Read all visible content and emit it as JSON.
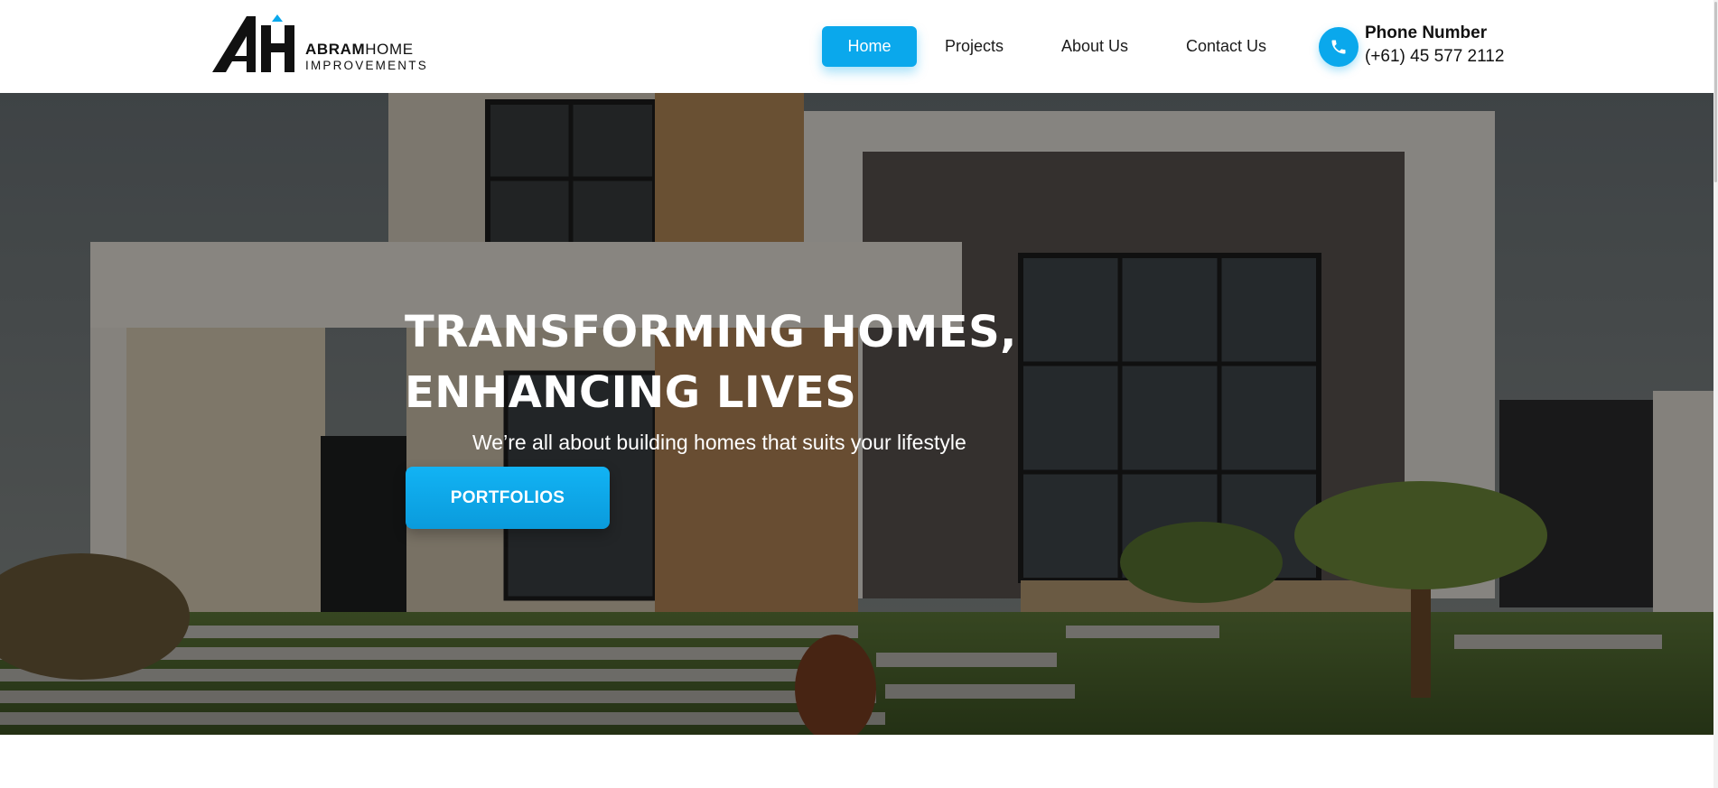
{
  "brand": {
    "name_bold": "ABRAM",
    "name_regular": "HOME",
    "tagline": "IMPROVEMENTS",
    "accent_color": "#0aa8ec"
  },
  "nav": {
    "items": [
      {
        "label": "Home",
        "active": true
      },
      {
        "label": "Projects",
        "active": false
      },
      {
        "label": "About Us",
        "active": false
      },
      {
        "label": "Contact Us",
        "active": false
      }
    ]
  },
  "contact": {
    "icon": "phone-icon",
    "label": "Phone Number",
    "number": "(+61) 45 577 2112"
  },
  "hero": {
    "title_line1": "TRANSFORMING HOMES,",
    "title_line2": "ENHANCING LIVES",
    "subtitle": "We’re all about building homes that suits your lifestyle",
    "cta_label": "PORTFOLIOS",
    "background": "modern-house-photo"
  }
}
